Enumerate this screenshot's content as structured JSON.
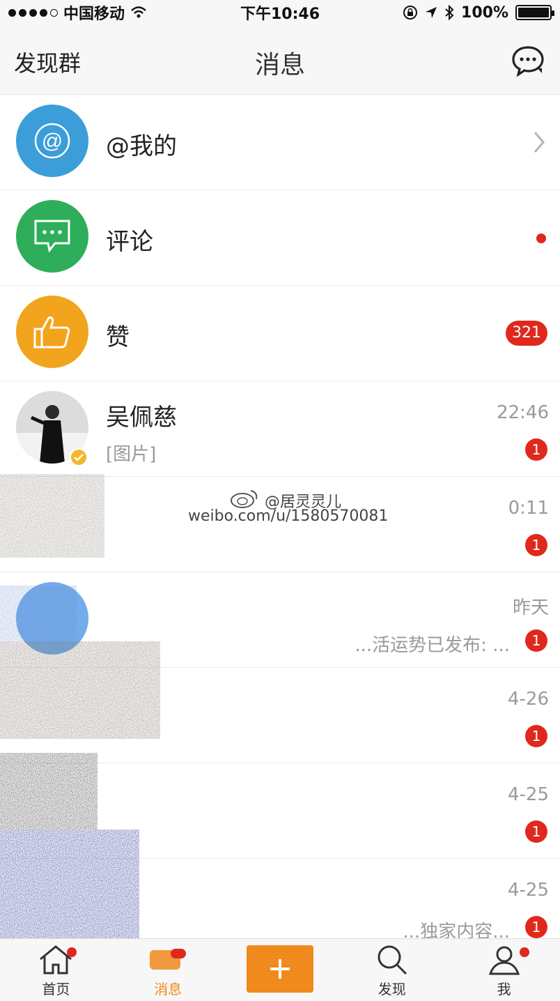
{
  "status_bar": {
    "carrier": "中国移动",
    "time": "下午10:46",
    "battery": "100%"
  },
  "nav": {
    "left": "发现群",
    "title": "消息"
  },
  "rows": {
    "mentions": {
      "title": "@我的"
    },
    "comments": {
      "title": "评论"
    },
    "likes": {
      "title": "赞",
      "badge": "321"
    },
    "wupeici": {
      "title": "吴佩慈",
      "subtitle": "[图片]",
      "time": "22:46",
      "badge": "1"
    },
    "row5": {
      "time": "0:11",
      "badge": "1"
    },
    "row6": {
      "time": "昨天",
      "subtitle": "...活运势已发布: ...",
      "badge": "1"
    },
    "row7": {
      "time": "4-26",
      "badge": "1"
    },
    "row8": {
      "time": "4-25",
      "badge": "1"
    },
    "row9": {
      "time": "4-25",
      "subtitle": "...独家内容...",
      "badge": "1"
    }
  },
  "watermark": {
    "handle": "@居灵灵儿",
    "url": "weibo.com/u/1580570081"
  },
  "tabs": {
    "home": "首页",
    "messages": "消息",
    "discover": "发现",
    "me": "我"
  },
  "colors": {
    "accent": "#f08a1c",
    "badge": "#e0281d",
    "mention": "#3b9ed8",
    "comment": "#2eae5a",
    "like": "#f3a41d"
  }
}
